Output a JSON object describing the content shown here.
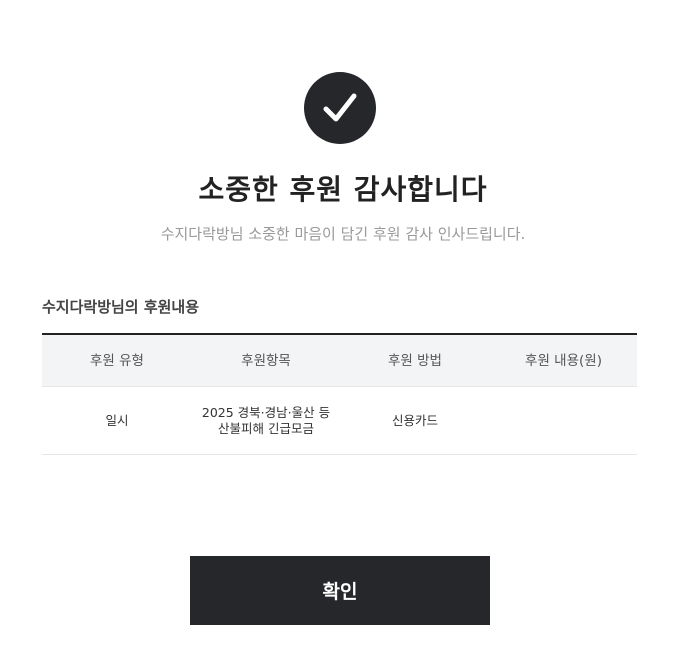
{
  "header": {
    "icon": "check-icon",
    "title": "소중한 후원 감사합니다",
    "subtitle": "수지다락방님 소중한 마음이 담긴 후원 감사 인사드립니다."
  },
  "donation": {
    "section_title": "수지다락방님의 후원내용",
    "columns": [
      "후원 유형",
      "후원항목",
      "후원 방법",
      "후원 내용(원)"
    ],
    "rows": [
      {
        "type": "일시",
        "item_line1": "2025 경북·경남·울산 등",
        "item_line2": "산불피해 긴급모금",
        "method": "신용카드",
        "amount": ""
      }
    ]
  },
  "actions": {
    "confirm_label": "확인"
  },
  "colors": {
    "primary_dark": "#26272a",
    "table_header_bg": "#f3f4f6",
    "subtitle_text": "#999999"
  }
}
